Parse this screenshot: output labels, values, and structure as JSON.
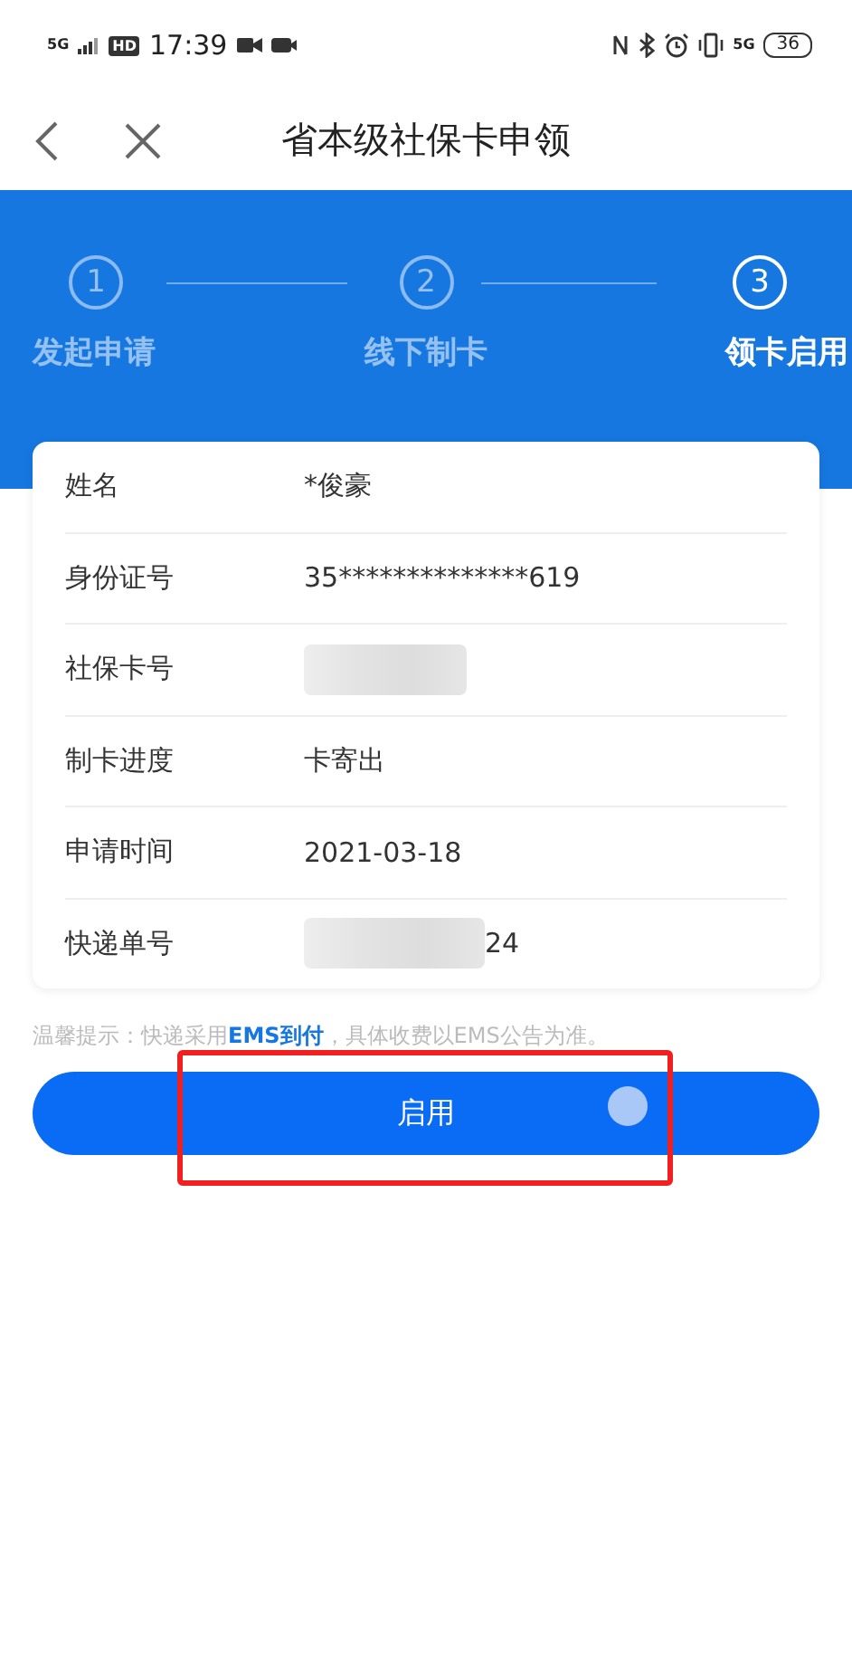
{
  "status_bar": {
    "network": "5G",
    "hd": "HD",
    "time": "17:39",
    "network_right": "5G",
    "battery": "36"
  },
  "title_bar": {
    "title": "省本级社保卡申领"
  },
  "steps": [
    {
      "number": "1",
      "label": "发起申请",
      "selected": false
    },
    {
      "number": "2",
      "label": "线下制卡",
      "selected": false
    },
    {
      "number": "3",
      "label": "领卡启用",
      "selected": true
    }
  ],
  "details": [
    {
      "label": "姓名",
      "kind": "text",
      "value": "*俊豪"
    },
    {
      "label": "身份证号",
      "kind": "text",
      "value": "35**************619"
    },
    {
      "label": "社保卡号",
      "kind": "blurred"
    },
    {
      "label": "制卡进度",
      "kind": "text",
      "value": "卡寄出"
    },
    {
      "label": "申请时间",
      "kind": "text",
      "value": "2021-03-18"
    },
    {
      "label": "快递单号",
      "kind": "partly_blurred",
      "value": "24"
    }
  ],
  "notice": "温馨提示：快递采用**EMS到付**，具体收费以EMS公告为准。",
  "primary_button": {
    "label": "启用",
    "highlighted": true,
    "touched": true
  }
}
